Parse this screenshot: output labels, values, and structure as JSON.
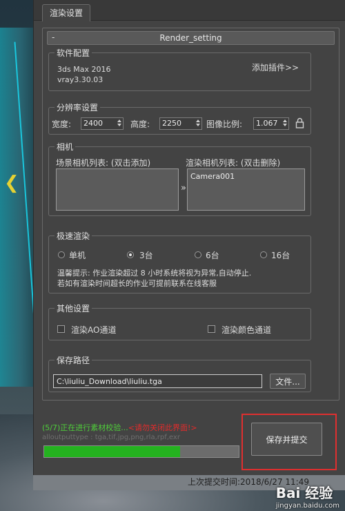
{
  "tab": {
    "label": "渲染设置"
  },
  "rollout": {
    "toggle": "-",
    "title": "Render_setting"
  },
  "software": {
    "title": "软件配置",
    "app_version": "3ds Max 2016",
    "renderer_version": "vray3.30.03",
    "add_plugin_link": "添加插件>>"
  },
  "resolution": {
    "title": "分辨率设置",
    "width_label": "宽度:",
    "width_value": "2400",
    "height_label": "高度:",
    "height_value": "2250",
    "ratio_label": "图像比例:",
    "ratio_value": "1.067",
    "lock_icon": "lock-icon"
  },
  "camera": {
    "title": "相机",
    "scene_list_label": "场景相机列表: (双击添加)",
    "render_list_label": "渲染相机列表: (双击删除)",
    "transfer_symbol": "»",
    "render_cameras": [
      "Camera001"
    ]
  },
  "fast_render": {
    "title": "极速渲染",
    "options": [
      "单机",
      "3台",
      "6台",
      "16台"
    ],
    "selected": "3台",
    "tip_line1": "温馨提示: 作业渲染超过 8 小时系统将视为异常,自动停止.",
    "tip_line2": "若如有渲染时间超长的作业可提前联系在线客服"
  },
  "other": {
    "title": "其他设置",
    "ao_label": "渲染AO通道",
    "ao_checked": false,
    "color_label": "渲染颜色通道",
    "color_checked": false
  },
  "save_path": {
    "title": "保存路径",
    "value": "C:\\liuliu_Download\\liuliu.tga",
    "file_button": "文件..."
  },
  "status": {
    "progress_text": "(5/7)正在进行素材校验...",
    "warning_text": "<请勿关闭此界面!>",
    "formats_hint": "alloutputtype : tga,tif,jpg,png,rla,rpf,exr",
    "progress": 0.7,
    "progress_color": "#24b21f"
  },
  "submit": {
    "label": "保存并提交",
    "highlight_color": "#e02f2f"
  },
  "last_submit": {
    "label": "上次提交时间:",
    "value": "2018/6/27 11:49"
  },
  "watermark": {
    "main": "Bai 经验",
    "sub": "jingyan.baidu.com"
  }
}
